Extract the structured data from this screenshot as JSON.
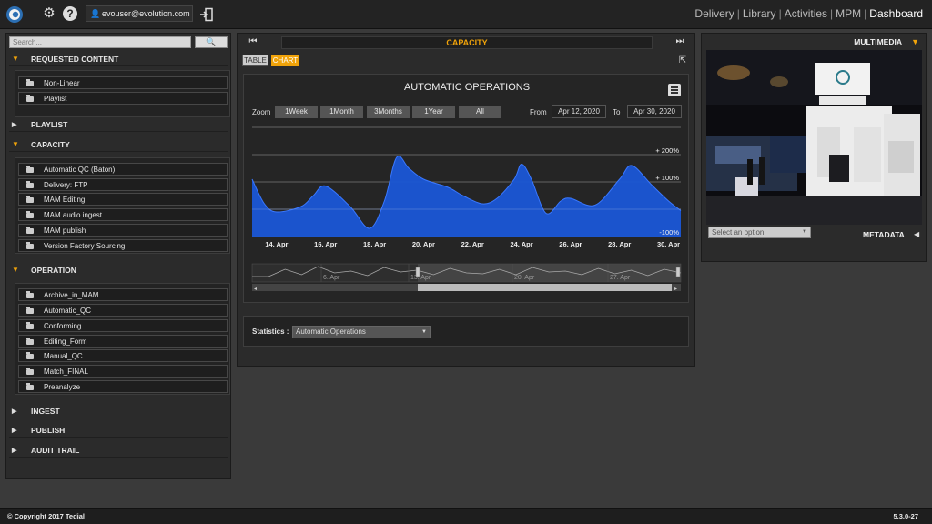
{
  "header": {
    "user": "evouser@evolution.com",
    "nav": [
      "Delivery",
      "Library",
      "Activities",
      "MPM",
      "Dashboard"
    ],
    "active_nav": "Dashboard",
    "icons": [
      "gear-icon",
      "help-icon",
      "user-icon",
      "logout-icon"
    ]
  },
  "sidebar": {
    "search_placeholder": "Search...",
    "sections": {
      "requested": {
        "label": "REQUESTED CONTENT",
        "items": [
          "Non-Linear",
          "Playlist"
        ]
      },
      "playlist": {
        "label": "PLAYLIST"
      },
      "capacity": {
        "label": "CAPACITY",
        "items": [
          "Automatic QC (Baton)",
          "Delivery: FTP",
          "MAM Editing",
          "MAM audio ingest",
          "MAM publish",
          "Version Factory Sourcing"
        ]
      },
      "operation": {
        "label": "OPERATION",
        "items": [
          "Archive_in_MAM",
          "Automatic_QC",
          "Conforming",
          "Editing_Form",
          "Manual_QC",
          "Match_FINAL",
          "Preanalyze"
        ]
      },
      "ingest": {
        "label": "INGEST"
      },
      "publish": {
        "label": "PUBLISH"
      },
      "audit": {
        "label": "AUDIT TRAIL"
      }
    }
  },
  "center": {
    "title": "CAPACITY",
    "tabs": {
      "table": "TABLE",
      "chart": "CHART"
    },
    "zoom": {
      "label": "Zoom",
      "buttons": [
        "1Week",
        "1Month",
        "3Months",
        "1Year",
        "All"
      ]
    },
    "from_label": "From",
    "from_value": "Apr 12, 2020",
    "to_label": "To",
    "to_value": "Apr 30, 2020",
    "statistics_label": "Statistics :",
    "statistics_value": "Automatic Operations"
  },
  "chart_data": {
    "type": "area",
    "title": "AUTOMATIC OPERATIONS",
    "y_tick_labels": [
      "+ 200%",
      "+ 100%",
      "-100%"
    ],
    "x_tick_labels": [
      "14. Apr",
      "16. Apr",
      "18. Apr",
      "20. Apr",
      "22. Apr",
      "24. Apr",
      "26. Apr",
      "28. Apr",
      "30. Apr"
    ],
    "navigator_labels": [
      "6. Apr",
      "13. Apr",
      "20. Apr",
      "27. Apr"
    ],
    "x": [
      "13. Apr",
      "13.5 Apr",
      "14. Apr",
      "15. Apr",
      "15.5 Apr",
      "16. Apr",
      "17. Apr",
      "17.8 Apr",
      "18.4 Apr",
      "18.9 Apr",
      "19.4 Apr",
      "20. Apr",
      "21. Apr",
      "21.6 Apr",
      "22.4 Apr",
      "23. Apr",
      "23.7 Apr",
      "24. Apr",
      "24.4 Apr",
      "25. Apr",
      "25.6 Apr",
      "26. Apr",
      "27. Apr",
      "28. Apr",
      "28.5 Apr",
      "29.3 Apr",
      "30. Apr",
      "30.5 Apr"
    ],
    "values": [
      110,
      20,
      -10,
      10,
      50,
      85,
      10,
      -70,
      30,
      190,
      150,
      110,
      80,
      50,
      20,
      40,
      110,
      165,
      110,
      -15,
      30,
      40,
      15,
      110,
      160,
      90,
      30,
      -5
    ],
    "series_color": "#1a56d6",
    "ylim": [
      -100,
      300
    ]
  }
}
